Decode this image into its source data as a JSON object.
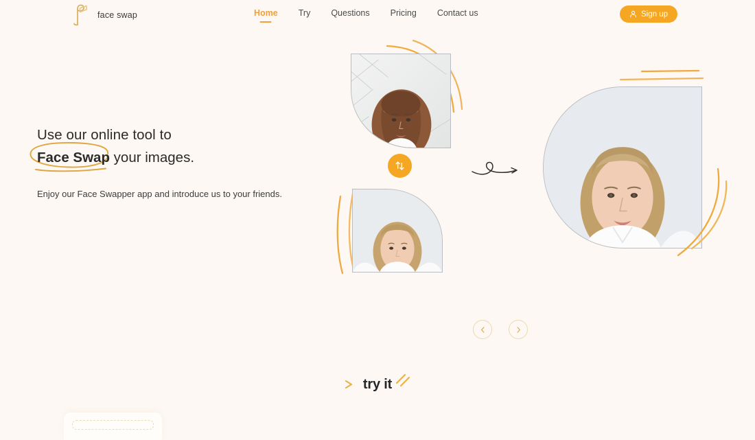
{
  "brand": {
    "name": "face swap",
    "logo_icon": "face-swap-logo-icon",
    "logo_color": "#D9AE5A"
  },
  "nav": {
    "items": [
      {
        "label": "Home",
        "active": true
      },
      {
        "label": "Try",
        "active": false
      },
      {
        "label": "Questions",
        "active": false
      },
      {
        "label": "Pricing",
        "active": false
      },
      {
        "label": "Contact us",
        "active": false
      }
    ]
  },
  "header": {
    "signup_label": "Sign up",
    "signup_icon": "user-icon",
    "accent_color": "#F5A623"
  },
  "hero": {
    "heading_line1": "Use our online tool to",
    "heading_highlight": "Face Swap",
    "heading_line2_rest": " your images.",
    "subtext": "Enjoy our Face Swapper app and introduce us to your friends.",
    "highlight_circle_color": "#E0A441"
  },
  "swap_widget": {
    "source_top_alt": "Portrait of woman with long brown hair",
    "source_bottom_alt": "Portrait of young man with blond hair",
    "result_alt": "Face swapped result portrait",
    "swap_button_icon": "swap-arrows-icon",
    "transition_arrow_icon": "curly-arrow-icon",
    "accent_color": "#F5A623"
  },
  "carousel": {
    "prev_icon": "chevron-left-icon",
    "next_icon": "chevron-right-icon",
    "border_color": "#EBD9B4"
  },
  "cta": {
    "try_label": "try it",
    "deco_color": "#E9B24C"
  },
  "colors": {
    "background": "#FDF8F3",
    "text": "#2B2B2B",
    "orange": "#F5A623",
    "gold": "#D9AE5A"
  }
}
